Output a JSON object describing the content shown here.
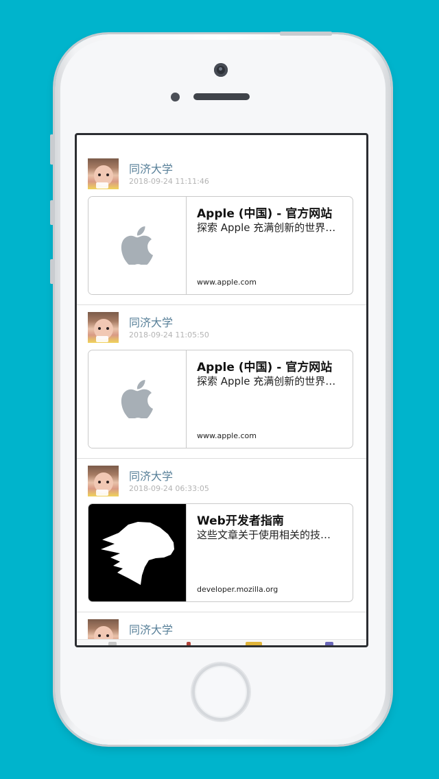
{
  "feed": {
    "posts": [
      {
        "user": "同济大学",
        "time": "2018-09-24 11:11:46",
        "card": {
          "title": "Apple (中国) - 官方网站",
          "description": "探索 Apple 充满创新的世界…",
          "url": "www.apple.com",
          "thumb": "apple-logo-icon"
        }
      },
      {
        "user": "同济大学",
        "time": "2018-09-24 11:05:50",
        "card": {
          "title": "Apple (中国) - 官方网站",
          "description": "探索 Apple 充满创新的世界…",
          "url": "www.apple.com",
          "thumb": "apple-logo-icon"
        }
      },
      {
        "user": "同济大学",
        "time": "2018-09-24 06:33:05",
        "card": {
          "title": "Web开发者指南",
          "description": "这些文章关于使用相关的技…",
          "url": "developer.mozilla.org",
          "thumb": "mdn-dinosaur-icon"
        }
      },
      {
        "user": "同济大学"
      }
    ]
  },
  "colors": {
    "background": "#00b4cc",
    "username": "#577f98",
    "timestamp": "#b3b3b3"
  }
}
